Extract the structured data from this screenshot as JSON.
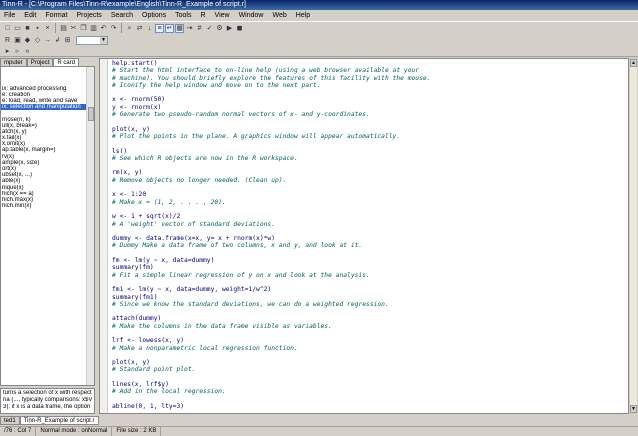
{
  "window": {
    "title": "Tinn-R - [C:\\Program Files\\Tinn-R\\example\\English\\Tinn-R_Example of script.r]"
  },
  "menu": [
    "File",
    "Edit",
    "Format",
    "Projects",
    "Search",
    "Options",
    "Tools",
    "R",
    "View",
    "Window",
    "Web",
    "Help"
  ],
  "left_tabs": [
    "mputer",
    "Project",
    "R card"
  ],
  "left_list": [
    "",
    "",
    "",
    "ix: advanced processing",
    "e: creation",
    "e: load, read, write and save",
    "ix: selection and manipulation",
    "",
    "rnose(n, k)",
    "ull(x, break=)",
    "atch(x, y)",
    "x.fail(x)",
    "x.omit(x)",
    "ap.table(x, margin=)",
    "rv(x)",
    "ample(x, size)",
    "ort(x)",
    "ubset(x, ...)",
    "able(x)",
    "nique(x)",
    "hich(x == a)",
    "hich.max(x)",
    "hich.min(x)"
  ],
  "info_lines": [
    "turns a selection of x with respect to",
    "ria (..., typically comparisons: x$V1",
    "3); if x is a data frame, the option"
  ],
  "code_lines": [
    [
      "c",
      "help.start()"
    ],
    [
      "m",
      "# Start the html interface to on-line help (using a web browser available at your"
    ],
    [
      "m",
      "# machine). You should briefly explore the features of this facility with the mouse."
    ],
    [
      "m",
      "# Iconify the help window and move on to the next part."
    ],
    [
      "b",
      ""
    ],
    [
      "c",
      "x <- rnorm(50)"
    ],
    [
      "c",
      "y <- rnorm(x)"
    ],
    [
      "m",
      "# Generate two pseudo-random normal vectors of x- and y-coordinates."
    ],
    [
      "b",
      ""
    ],
    [
      "c",
      "plot(x, y)"
    ],
    [
      "m",
      "# Plot the points in the plane. A graphics window will appear automatically."
    ],
    [
      "b",
      ""
    ],
    [
      "c",
      "ls()"
    ],
    [
      "m",
      "# See which R objects are now in the R workspace."
    ],
    [
      "b",
      ""
    ],
    [
      "c",
      "rm(x, y)"
    ],
    [
      "m",
      "# Remove objects no longer needed. (Clean up)."
    ],
    [
      "b",
      ""
    ],
    [
      "c",
      "x <- 1:20"
    ],
    [
      "m",
      "# Make x = (1, 2, . . . , 20)."
    ],
    [
      "b",
      ""
    ],
    [
      "c",
      "w <- 1 + sqrt(x)/2"
    ],
    [
      "m",
      "# A 'weight' vector of standard deviations."
    ],
    [
      "b",
      ""
    ],
    [
      "c",
      "dummy <- data.frame(x=x, y= x + rnorm(x)*w)"
    ],
    [
      "m",
      "# Dummy Make a data frame of two columns, x and y, and look at it."
    ],
    [
      "b",
      ""
    ],
    [
      "c",
      "fm <- lm(y ~ x, data=dummy)"
    ],
    [
      "c",
      "summary(fm)"
    ],
    [
      "m",
      "# Fit a simple linear regression of y on x and look at the analysis."
    ],
    [
      "b",
      ""
    ],
    [
      "c",
      "fm1 <- lm(y ~ x, data=dummy, weight=1/w^2)"
    ],
    [
      "c",
      "summary(fm1)"
    ],
    [
      "m",
      "# Since we know the standard deviations, we can do a weighted regression."
    ],
    [
      "b",
      ""
    ],
    [
      "c",
      "attach(dummy)"
    ],
    [
      "m",
      "# Make the columns in the data frame visible as variables."
    ],
    [
      "b",
      ""
    ],
    [
      "c",
      "lrf <- lowess(x, y)"
    ],
    [
      "m",
      "# Make a nonparametric local regression function."
    ],
    [
      "b",
      ""
    ],
    [
      "c",
      "plot(x, y)"
    ],
    [
      "m",
      "# Standard point plot."
    ],
    [
      "b",
      ""
    ],
    [
      "c",
      "lines(x, lrf$y)"
    ],
    [
      "m",
      "# Add in the local regression."
    ],
    [
      "b",
      ""
    ],
    [
      "c",
      "abline(0, 1, lty=3)"
    ]
  ],
  "bottom_tabs": [
    "ted1",
    "Tinn-R_Example of script.r"
  ],
  "status": {
    "position": "/76 : Col 7",
    "mode": "Normal mode : onNormal",
    "filesize": "File size : 2 KB"
  },
  "colors": {
    "code": "#000080",
    "comment": "#006060",
    "selection": "#3168c6"
  }
}
